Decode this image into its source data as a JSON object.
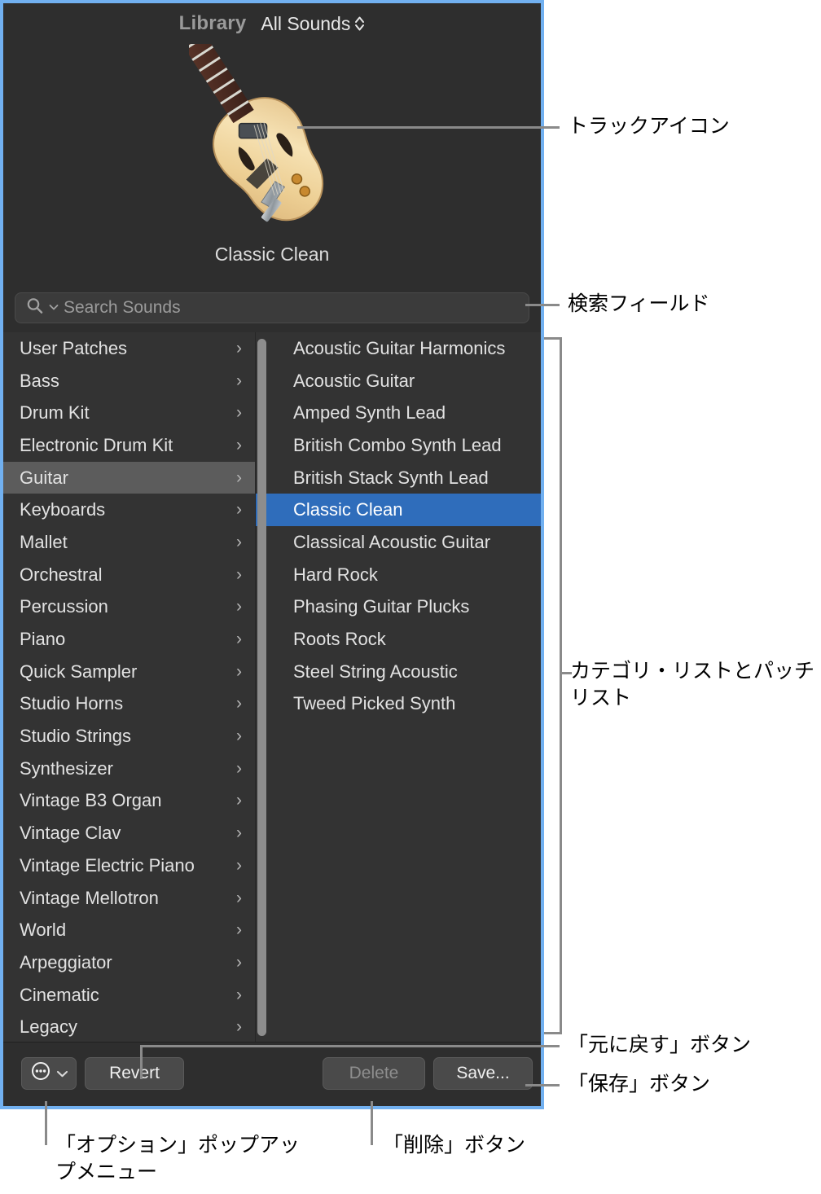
{
  "window": {
    "header": {
      "library_label": "Library",
      "sound_set": "All Sounds",
      "sound_set_icon": "up-down-chevrons-icon"
    },
    "track_icon": {
      "icon_name": "electric-guitar-icon",
      "patch_name": "Classic Clean"
    },
    "search": {
      "placeholder": "Search Sounds",
      "value": "",
      "icon": "search-magnifier-icon",
      "menu_icon": "chevron-down-icon"
    },
    "categories": [
      {
        "label": "User Patches",
        "selected": false
      },
      {
        "label": "Bass",
        "selected": false
      },
      {
        "label": "Drum Kit",
        "selected": false
      },
      {
        "label": "Electronic Drum Kit",
        "selected": false
      },
      {
        "label": "Guitar",
        "selected": true
      },
      {
        "label": "Keyboards",
        "selected": false
      },
      {
        "label": "Mallet",
        "selected": false
      },
      {
        "label": "Orchestral",
        "selected": false
      },
      {
        "label": "Percussion",
        "selected": false
      },
      {
        "label": "Piano",
        "selected": false
      },
      {
        "label": "Quick Sampler",
        "selected": false
      },
      {
        "label": "Studio Horns",
        "selected": false
      },
      {
        "label": "Studio Strings",
        "selected": false
      },
      {
        "label": "Synthesizer",
        "selected": false
      },
      {
        "label": "Vintage B3 Organ",
        "selected": false
      },
      {
        "label": "Vintage Clav",
        "selected": false
      },
      {
        "label": "Vintage Electric Piano",
        "selected": false
      },
      {
        "label": "Vintage Mellotron",
        "selected": false
      },
      {
        "label": "World",
        "selected": false
      },
      {
        "label": "Arpeggiator",
        "selected": false
      },
      {
        "label": "Cinematic",
        "selected": false
      },
      {
        "label": "Legacy",
        "selected": false
      }
    ],
    "category_chevron": "›",
    "patches": [
      {
        "label": "Acoustic Guitar Harmonics",
        "selected": false
      },
      {
        "label": "Acoustic Guitar",
        "selected": false
      },
      {
        "label": "Amped Synth Lead",
        "selected": false
      },
      {
        "label": "British Combo Synth Lead",
        "selected": false
      },
      {
        "label": "British Stack Synth Lead",
        "selected": false
      },
      {
        "label": "Classic Clean",
        "selected": true
      },
      {
        "label": "Classical Acoustic Guitar",
        "selected": false
      },
      {
        "label": "Hard Rock",
        "selected": false
      },
      {
        "label": "Phasing Guitar Plucks",
        "selected": false
      },
      {
        "label": "Roots Rock",
        "selected": false
      },
      {
        "label": "Steel String Acoustic",
        "selected": false
      },
      {
        "label": "Tweed Picked Synth",
        "selected": false
      }
    ],
    "buttons": {
      "options_icon": "circle-ellipsis-icon",
      "options_chevron": "chevron-down-icon",
      "revert": "Revert",
      "delete": "Delete",
      "save": "Save..."
    }
  },
  "annotations": {
    "track_icon": "トラックアイコン",
    "search_field": "検索フィールド",
    "category_and_patch_list": "カテゴリ・リストとパッチ\nリスト",
    "revert_button": "「元に戻す」ボタン",
    "save_button": "「保存」ボタン",
    "options_menu": "「オプション」ポップアッ\nプメニュー",
    "delete_button": "「削除」ボタン"
  },
  "colors": {
    "window_border": "#71b0f0",
    "window_bg": "#2e2e2e",
    "list_bg": "#333333",
    "selected_category": "#5c5c5c",
    "selected_patch": "#2f6dbb",
    "leader_line": "#8a8a8a"
  }
}
